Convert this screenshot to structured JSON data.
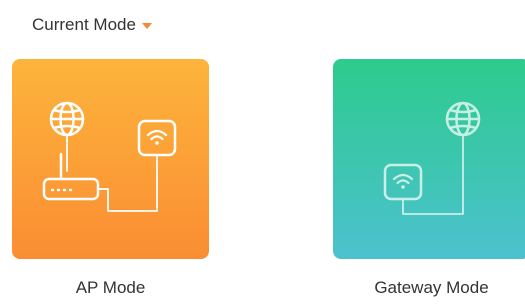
{
  "header": {
    "current_mode_label": "Current Mode",
    "dropdown_icon": "caret-down-icon",
    "accent_color": "#f4893a"
  },
  "modes": [
    {
      "label": "AP Mode",
      "colors": {
        "top": "#fdb43c",
        "bottom": "#fa8d33"
      },
      "icons": [
        "globe-icon",
        "router-icon",
        "wifi-extender-icon"
      ]
    },
    {
      "label": "Gateway Mode",
      "colors": {
        "top": "#2dcb8d",
        "bottom": "#4cc1cf"
      },
      "icons": [
        "globe-icon",
        "wifi-extender-icon"
      ]
    }
  ]
}
